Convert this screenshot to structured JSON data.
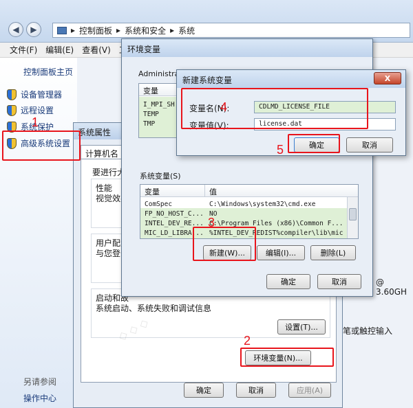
{
  "address_bar": {
    "segments": [
      "控制面板",
      "系统和安全",
      "系统"
    ]
  },
  "menu": [
    "文件(F)",
    "编辑(E)",
    "查看(V)",
    "工"
  ],
  "sidebar": {
    "home": "控制面板主页",
    "items": [
      "设备管理器",
      "远程设置",
      "系统保护",
      "高级系统设置"
    ],
    "see_also": "另请参阅",
    "action_center": "操作中心"
  },
  "right_side_text": {
    "cpu": "@ 3.60GH",
    "touch": "笔或触控输入"
  },
  "system_properties": {
    "title": "系统属性",
    "tab_computer_name": "计算机名",
    "tab_partial": "",
    "intro": "要进行大",
    "perf_label": "性能",
    "perf_desc": "视觉效果",
    "profile_label": "用户配置",
    "profile_desc": "与您登录",
    "startup_label": "启动和故",
    "startup_desc": "系统启动、系统失败和调试信息",
    "settings_button": "设置(T)...",
    "env_button": "环境变量(N)...",
    "ok": "确定",
    "cancel": "取消",
    "apply": "应用(A)"
  },
  "env_vars": {
    "title": "环境变量",
    "user_group": "Administra",
    "user_header_var": "变量",
    "user_vars": [
      "I_MPI_SH",
      "TEMP",
      "TMP"
    ],
    "system_group": "系统变量(S)",
    "col_var": "变量",
    "col_val": "值",
    "system_rows": [
      {
        "name": "ComSpec",
        "value": "C:\\Windows\\system32\\cmd.exe"
      },
      {
        "name": "FP_NO_HOST_C...",
        "value": "NO"
      },
      {
        "name": "INTEL_DEV_RE...",
        "value": "C:\\Program Files (x86)\\Common F..."
      },
      {
        "name": "MIC_LD_LIBRA...",
        "value": "%INTEL_DEV_REDIST%compiler\\lib\\mic"
      }
    ],
    "new_button": "新建(W)...",
    "edit_button": "编辑(I)...",
    "delete_button": "删除(L)",
    "ok": "确定",
    "cancel": "取消"
  },
  "new_var": {
    "title": "新建系统变量",
    "close": "X",
    "name_label": "变量名(N):",
    "value_label": "变量值(V):",
    "name_value": "CDLMD_LICENSE_FILE",
    "value_value": "license.dat",
    "ok": "确定",
    "cancel": "取消"
  },
  "annotations": [
    "1",
    "2",
    "3",
    "4",
    "5"
  ],
  "colors": {
    "annotation": "#e8141b",
    "title_bar": "#bfd3ec",
    "link": "#1a3b7a"
  }
}
